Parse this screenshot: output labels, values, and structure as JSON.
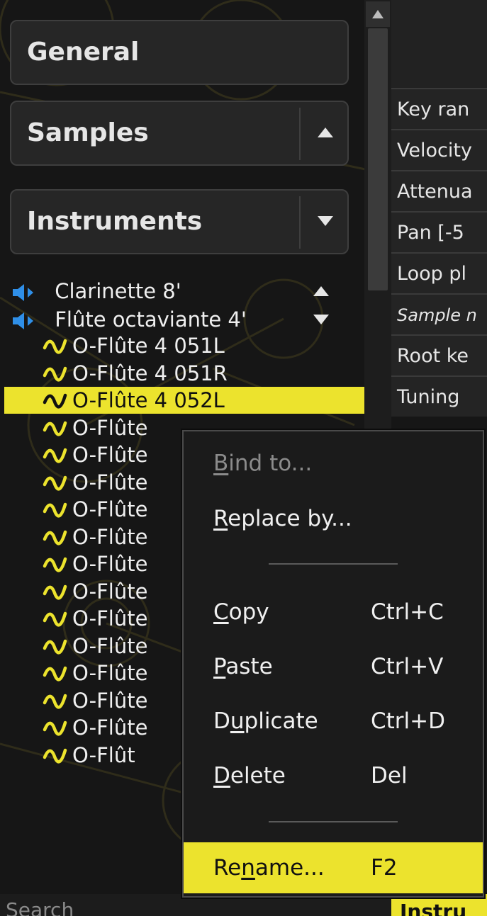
{
  "sections": {
    "general": {
      "label": "General"
    },
    "samples": {
      "label": "Samples",
      "toggle_icon": "triangle-up"
    },
    "instruments": {
      "label": "Instruments",
      "toggle_icon": "triangle-down"
    }
  },
  "tree": {
    "instruments": [
      {
        "label": "Clarinette 8'",
        "icon": "speaker-icon",
        "expander": "triangle-up"
      },
      {
        "label": "Flûte octaviante 4'",
        "icon": "speaker-icon",
        "expander": "triangle-down"
      }
    ],
    "samples": [
      {
        "label": "O-Flûte 4 051L",
        "selected": false
      },
      {
        "label": "O-Flûte 4 051R",
        "selected": false
      },
      {
        "label": "O-Flûte 4 052L",
        "selected": true
      },
      {
        "label": "O-Flûte",
        "selected": false
      },
      {
        "label": "O-Flûte",
        "selected": false
      },
      {
        "label": "O-Flûte",
        "selected": false
      },
      {
        "label": "O-Flûte",
        "selected": false
      },
      {
        "label": "O-Flûte",
        "selected": false
      },
      {
        "label": "O-Flûte",
        "selected": false
      },
      {
        "label": "O-Flûte",
        "selected": false
      },
      {
        "label": "O-Flûte",
        "selected": false
      },
      {
        "label": "O-Flûte",
        "selected": false
      },
      {
        "label": "O-Flûte",
        "selected": false
      },
      {
        "label": "O-Flûte",
        "selected": false
      },
      {
        "label": "O-Flûte",
        "selected": false
      },
      {
        "label": "O-Flût",
        "selected": false
      }
    ]
  },
  "table": {
    "rows": [
      {
        "label": "Key ran"
      },
      {
        "label": "Velocity"
      },
      {
        "label": "Attenua"
      },
      {
        "label": "Pan [-5"
      },
      {
        "label": "Loop pl"
      },
      {
        "label": "Sample n",
        "italic": true
      },
      {
        "label": "Root ke"
      },
      {
        "label": "Tuning"
      }
    ]
  },
  "context_menu": {
    "bind_to": {
      "label": "Bind to...",
      "enabled": false
    },
    "replace_by": {
      "label": "Replace by..."
    },
    "copy": {
      "label": "Copy",
      "shortcut": "Ctrl+C"
    },
    "paste": {
      "label": "Paste",
      "shortcut": "Ctrl+V"
    },
    "duplicate": {
      "label": "Duplicate",
      "shortcut": "Ctrl+D"
    },
    "delete": {
      "label": "Delete",
      "shortcut": "Del"
    },
    "rename": {
      "label": "Rename...",
      "shortcut": "F2",
      "highlighted": true
    }
  },
  "search": {
    "placeholder": "Search"
  },
  "bottom_tab": {
    "label": "Instru"
  },
  "colors": {
    "accent": "#ece32d",
    "speaker": "#2f8fe8",
    "background": "#161616"
  }
}
